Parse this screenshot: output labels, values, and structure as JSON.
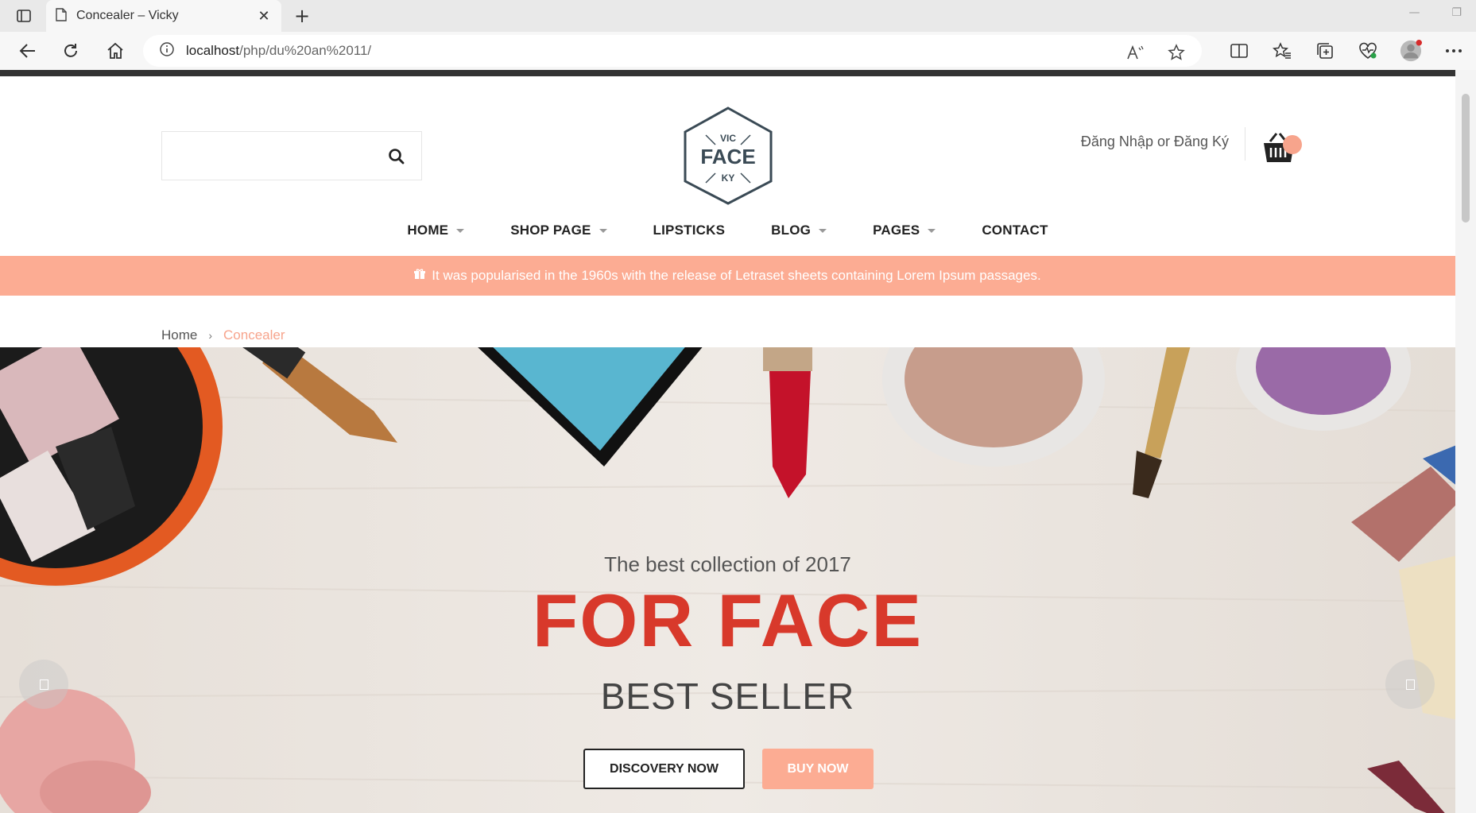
{
  "browser": {
    "tab_title": "Concealer – Vicky",
    "url_host": "localhost",
    "url_path": "/php/du%20an%2011/",
    "icons": [
      "tab-actions-icon",
      "page-icon",
      "close-icon",
      "plus-icon",
      "back-icon",
      "reload-icon",
      "home-icon",
      "info-icon",
      "read-aloud-icon",
      "star-icon",
      "split-screen-icon",
      "favorites-icon",
      "collections-icon",
      "performance-icon",
      "profile-icon",
      "more-icon"
    ]
  },
  "header": {
    "search_placeholder": "",
    "logo": {
      "top": "VIC",
      "middle": "FACE",
      "bottom": "KY"
    },
    "login_text": "Đăng Nhập or Đăng Ký"
  },
  "nav": [
    {
      "label": "HOME",
      "dropdown": true
    },
    {
      "label": "SHOP PAGE",
      "dropdown": true
    },
    {
      "label": "LIPSTICKS",
      "dropdown": false
    },
    {
      "label": "BLOG",
      "dropdown": true
    },
    {
      "label": "PAGES",
      "dropdown": true
    },
    {
      "label": "CONTACT",
      "dropdown": false
    }
  ],
  "promo": {
    "text": "It was popularised in the 1960s with the release of Letraset sheets containing Lorem Ipsum passages."
  },
  "breadcrumb": {
    "home": "Home",
    "current": "Concealer"
  },
  "hero": {
    "subtitle": "The best collection of 2017",
    "title": "FOR FACE",
    "tagline": "BEST SELLER",
    "discover_label": "DISCOVERY NOW",
    "buy_label": "BUY NOW"
  },
  "colors": {
    "accent": "#fcac93",
    "title_red": "#d8392b",
    "dark": "#333333"
  }
}
